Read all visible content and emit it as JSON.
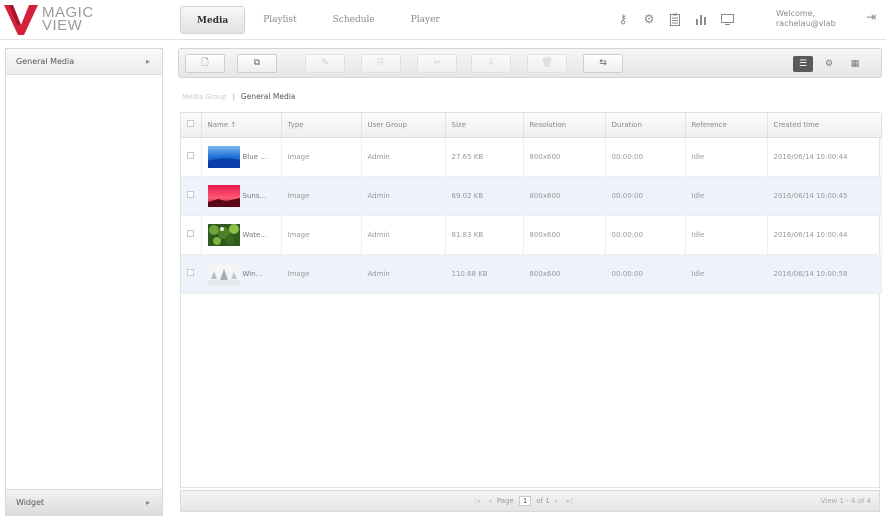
{
  "app": {
    "logo_line1": "MAGIC",
    "logo_line2": "VIEW",
    "brand_color": "#d4203a"
  },
  "header": {
    "tabs": [
      {
        "label": "Media",
        "active": true
      },
      {
        "label": "Playlist",
        "active": false
      },
      {
        "label": "Schedule",
        "active": false
      },
      {
        "label": "Player",
        "active": false
      }
    ],
    "icons": [
      "key-icon",
      "gear-icon",
      "clipboard-icon",
      "bar-chart-icon",
      "monitor-icon"
    ],
    "welcome_line1": "Welcome,",
    "welcome_line2": "rachelau@vlab",
    "logout_icon": "logout-icon"
  },
  "sidebar": {
    "top_section": "General Media",
    "bottom_section": "Widget"
  },
  "toolbar": {
    "buttons": [
      {
        "icon": "new-file-icon",
        "glyph": "🗋",
        "enabled": true
      },
      {
        "icon": "new-folder-icon",
        "glyph": "⧉",
        "enabled": true
      },
      {
        "icon": "edit-icon",
        "glyph": "✎",
        "enabled": false
      },
      {
        "icon": "copy-icon",
        "glyph": "⎘",
        "enabled": false
      },
      {
        "icon": "cut-icon",
        "glyph": "✂",
        "enabled": false
      },
      {
        "icon": "download-icon",
        "glyph": "⇩",
        "enabled": false
      },
      {
        "icon": "delete-icon",
        "glyph": "🗑",
        "enabled": false
      },
      {
        "icon": "move-icon",
        "glyph": "⇆",
        "enabled": true
      }
    ],
    "view_buttons": [
      {
        "icon": "list-view-icon",
        "glyph": "☰",
        "active": true
      },
      {
        "icon": "settings-view-icon",
        "glyph": "⚙",
        "active": false
      },
      {
        "icon": "grid-view-icon",
        "glyph": "▦",
        "active": false
      }
    ]
  },
  "breadcrumb": {
    "root": "Media Group",
    "current": "General Media"
  },
  "table": {
    "columns": [
      "Name ↑",
      "Type",
      "User Group",
      "Size",
      "Resolution",
      "Duration",
      "Reference",
      "Created time"
    ],
    "rows": [
      {
        "name": "Blue ...",
        "type": "Image",
        "group": "Admin",
        "size": "27.65 KB",
        "resolution": "800x600",
        "duration": "00:00:00",
        "reference": "Idle",
        "created": "2016/06/14 10:00:44",
        "thumb": "blue"
      },
      {
        "name": "Suns...",
        "type": "Image",
        "group": "Admin",
        "size": "69.02 KB",
        "resolution": "800x600",
        "duration": "00:00:00",
        "reference": "Idle",
        "created": "2016/06/14 10:00:45",
        "thumb": "sunset"
      },
      {
        "name": "Wate...",
        "type": "Image",
        "group": "Admin",
        "size": "81.83 KB",
        "resolution": "800x600",
        "duration": "00:00:00",
        "reference": "Idle",
        "created": "2016/06/14 10:00:44",
        "thumb": "water"
      },
      {
        "name": "Win...",
        "type": "Image",
        "group": "Admin",
        "size": "110.68 KB",
        "resolution": "800x600",
        "duration": "00:00:00",
        "reference": "Idle",
        "created": "2016/06/14 10:00:58",
        "thumb": "winter"
      }
    ]
  },
  "pager": {
    "first": "|◂",
    "prev": "◂",
    "page_label": "Page",
    "page_value": "1",
    "of_label": "of 1",
    "next": "▸",
    "last": "▸|",
    "summary": "View 1 - 4 of 4"
  }
}
